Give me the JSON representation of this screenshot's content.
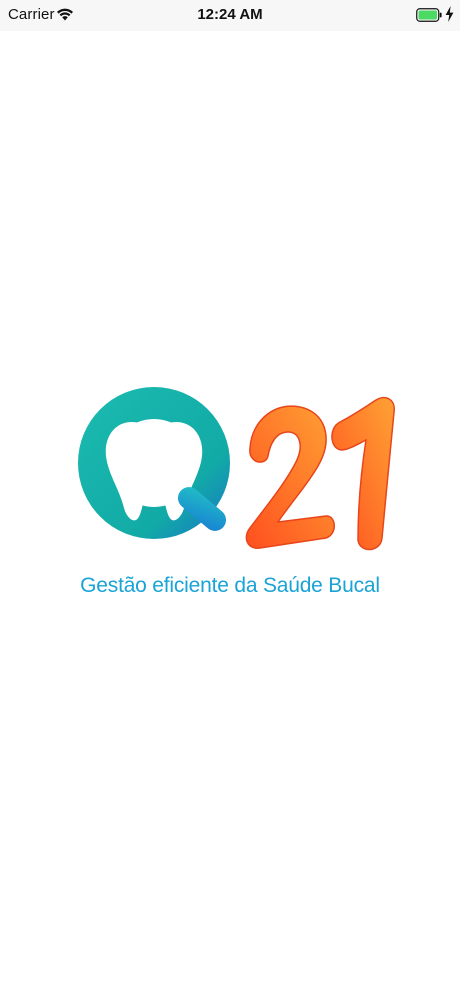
{
  "status_bar": {
    "carrier": "Carrier",
    "time": "12:24 AM",
    "icons": [
      "wifi-icon",
      "battery-icon",
      "charging-bolt-icon"
    ]
  },
  "splash": {
    "logo_text": "Q21",
    "tagline": "Gestão eficiente da Saúde Bucal",
    "logo_icons": [
      "tooth-icon"
    ]
  },
  "colors": {
    "teal": "#13b2a8",
    "orange": "#ff5e24",
    "orange_light": "#ff9a32",
    "tagline_blue": "#1aa3d6",
    "status_bar_bg": "#f7f7f7",
    "battery_green": "#4cd964"
  }
}
